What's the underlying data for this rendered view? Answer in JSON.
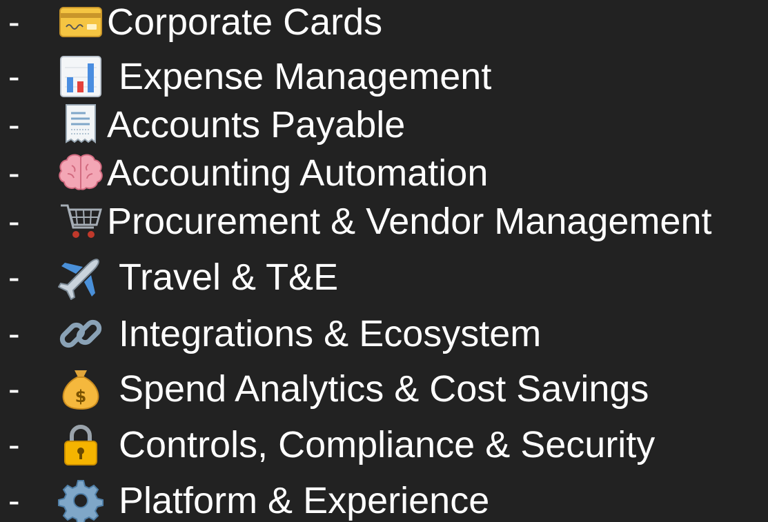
{
  "items": [
    {
      "dash": "-",
      "icon": "credit-card-icon",
      "label": "Corporate Cards"
    },
    {
      "dash": "-",
      "icon": "bar-chart-icon",
      "label": "Expense Management"
    },
    {
      "dash": "-",
      "icon": "receipt-icon",
      "label": "Accounts Payable"
    },
    {
      "dash": "-",
      "icon": "brain-icon",
      "label": "Accounting Automation"
    },
    {
      "dash": "-",
      "icon": "shopping-cart-icon",
      "label": "Procurement & Vendor Management"
    },
    {
      "dash": "-",
      "icon": "airplane-icon",
      "label": "Travel & T&E"
    },
    {
      "dash": "-",
      "icon": "link-icon",
      "label": "Integrations & Ecosystem"
    },
    {
      "dash": "-",
      "icon": "money-bag-icon",
      "label": "Spend Analytics & Cost Savings"
    },
    {
      "dash": "-",
      "icon": "lock-icon",
      "label": "Controls, Compliance & Security"
    },
    {
      "dash": "-",
      "icon": "gear-icon",
      "label": "Platform & Experience"
    }
  ],
  "colors": {
    "background": "#222222",
    "text": "#ffffff"
  }
}
